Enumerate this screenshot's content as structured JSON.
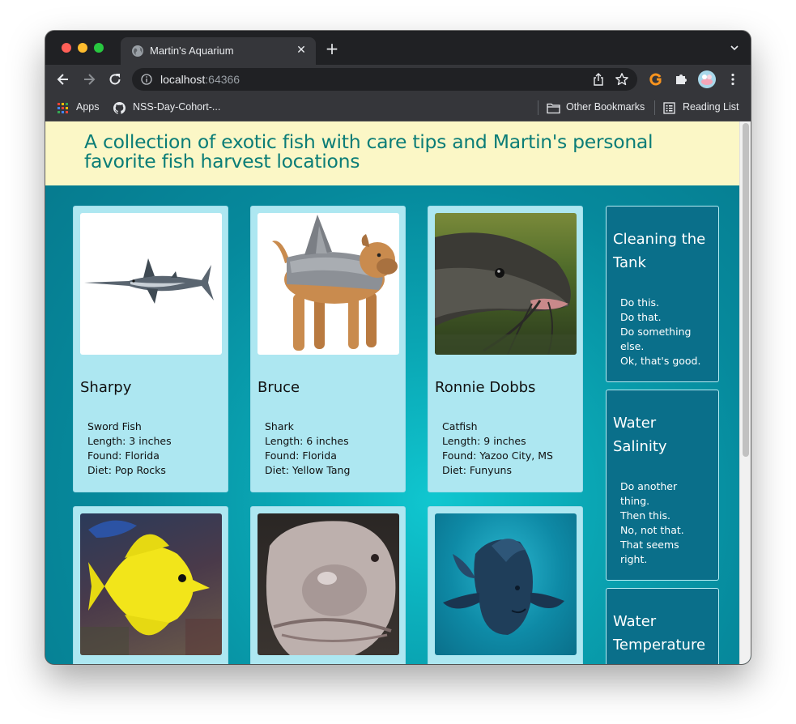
{
  "browser": {
    "tab": {
      "title": "Martin's Aquarium"
    },
    "url": {
      "host": "localhost",
      "port": ":64366"
    },
    "bookmarks": [
      {
        "label": "Apps",
        "icon": "apps-grid-icon"
      },
      {
        "label": "NSS-Day-Cohort-...",
        "icon": "github-icon"
      },
      {
        "label": "Other Bookmarks",
        "icon": "folder-icon"
      },
      {
        "label": "Reading List",
        "icon": "reading-list-icon"
      }
    ]
  },
  "page": {
    "banner_title": "A collection of exotic fish with care tips and Martin's personal favorite fish harvest locations",
    "fish": [
      {
        "name": "Sharpy",
        "species": "Sword Fish",
        "length": "Length: 3 inches",
        "found": "Found: Florida",
        "diet": "Diet: Pop Rocks",
        "image": "swordfish"
      },
      {
        "name": "Bruce",
        "species": "Shark",
        "length": "Length: 6 inches",
        "found": "Found: Florida",
        "diet": "Diet: Yellow Tang",
        "image": "dog-in-shark-costume"
      },
      {
        "name": "Ronnie Dobbs",
        "species": "Catfish",
        "length": "Length: 9 inches",
        "found": "Found: Yazoo City, MS",
        "diet": "Diet: Funyuns",
        "image": "catfish"
      },
      {
        "image": "yellow-tang"
      },
      {
        "image": "blobfish"
      },
      {
        "image": "humphead-fish"
      }
    ],
    "tips": [
      {
        "title": "Cleaning the Tank",
        "lines": [
          "Do this.",
          "Do that.",
          "Do something else.",
          "Ok, that's good."
        ]
      },
      {
        "title": "Water Salinity",
        "lines": [
          "Do another thing.",
          "Then this.",
          "No, not that.",
          "That seems right."
        ]
      },
      {
        "title": "Water Temperature",
        "lines": []
      }
    ]
  }
}
